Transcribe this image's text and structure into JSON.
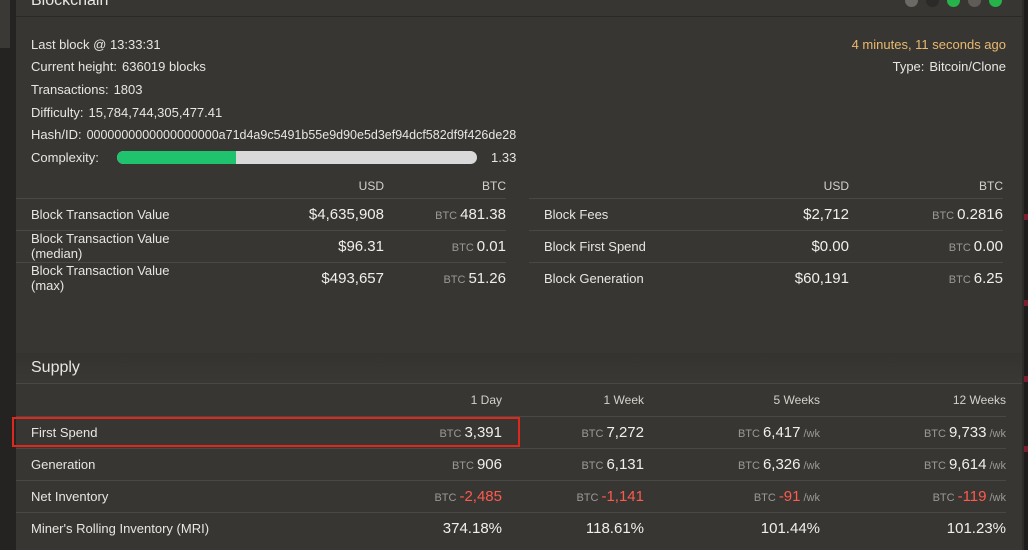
{
  "blockchain": {
    "title": "Blockchain",
    "last_block": "Last block @ 13:33:31",
    "time_ago": "4 minutes, 11 seconds ago",
    "type_label": "Type:",
    "type_value": "Bitcoin/Clone",
    "height_label": "Current height:",
    "height_value": "636019 blocks",
    "transactions_label": "Transactions:",
    "transactions_value": "1803",
    "difficulty_label": "Difficulty:",
    "difficulty_value": "15,784,744,305,477.41",
    "hash_label": "Hash/ID:",
    "hash_value": "0000000000000000000a71d4a9c5491b55e9d90e5d3ef94dcf582df9f426de28",
    "complexity_label": "Complexity:",
    "complexity_value": "1.33",
    "complexity_fraction": 0.33,
    "header_icon_colors": [
      "#6d6a66",
      "#2b2a28",
      "#25b34a",
      "#5f5c58",
      "#25b34a"
    ]
  },
  "left_table": {
    "col_usd": "USD",
    "col_btc": "BTC",
    "rows": [
      {
        "label": "Block Transaction Value",
        "usd": "$4,635,908",
        "btc_cur": "BTC",
        "btc": "481.38"
      },
      {
        "label": "Block Transaction Value (median)",
        "usd": "$96.31",
        "btc_cur": "BTC",
        "btc": "0.01"
      },
      {
        "label": "Block Transaction Value (max)",
        "usd": "$493,657",
        "btc_cur": "BTC",
        "btc": "51.26"
      }
    ]
  },
  "right_table": {
    "col_usd": "USD",
    "col_btc": "BTC",
    "rows": [
      {
        "label": "Block Fees",
        "usd": "$2,712",
        "btc_cur": "BTC",
        "btc": "0.2816"
      },
      {
        "label": "Block First Spend",
        "usd": "$0.00",
        "btc_cur": "BTC",
        "btc": "0.00"
      },
      {
        "label": "Block Generation",
        "usd": "$60,191",
        "btc_cur": "BTC",
        "btc": "6.25"
      }
    ]
  },
  "supply": {
    "title": "Supply",
    "columns": [
      "1 Day",
      "1 Week",
      "5 Weeks",
      "12 Weeks"
    ],
    "unit_wk": "/wk",
    "rows": [
      {
        "label": "First Spend",
        "cells": [
          {
            "cur": "BTC",
            "val": "3,391",
            "unit": ""
          },
          {
            "cur": "BTC",
            "val": "7,272",
            "unit": ""
          },
          {
            "cur": "BTC",
            "val": "6,417",
            "unit": "/wk"
          },
          {
            "cur": "BTC",
            "val": "9,733",
            "unit": "/wk"
          }
        ]
      },
      {
        "label": "Generation",
        "cells": [
          {
            "cur": "BTC",
            "val": "906",
            "unit": ""
          },
          {
            "cur": "BTC",
            "val": "6,131",
            "unit": ""
          },
          {
            "cur": "BTC",
            "val": "6,326",
            "unit": "/wk"
          },
          {
            "cur": "BTC",
            "val": "9,614",
            "unit": "/wk"
          }
        ]
      },
      {
        "label": "Net Inventory",
        "cells": [
          {
            "cur": "BTC",
            "val": "-2,485",
            "unit": ""
          },
          {
            "cur": "BTC",
            "val": "-1,141",
            "unit": ""
          },
          {
            "cur": "BTC",
            "val": "-91",
            "unit": "/wk"
          },
          {
            "cur": "BTC",
            "val": "-119",
            "unit": "/wk"
          }
        ]
      },
      {
        "label": "Miner's Rolling Inventory (MRI)",
        "cells": [
          {
            "cur": "",
            "val": "374.18%",
            "unit": ""
          },
          {
            "cur": "",
            "val": "118.61%",
            "unit": ""
          },
          {
            "cur": "",
            "val": "101.44%",
            "unit": ""
          },
          {
            "cur": "",
            "val": "101.23%",
            "unit": ""
          }
        ]
      }
    ]
  }
}
